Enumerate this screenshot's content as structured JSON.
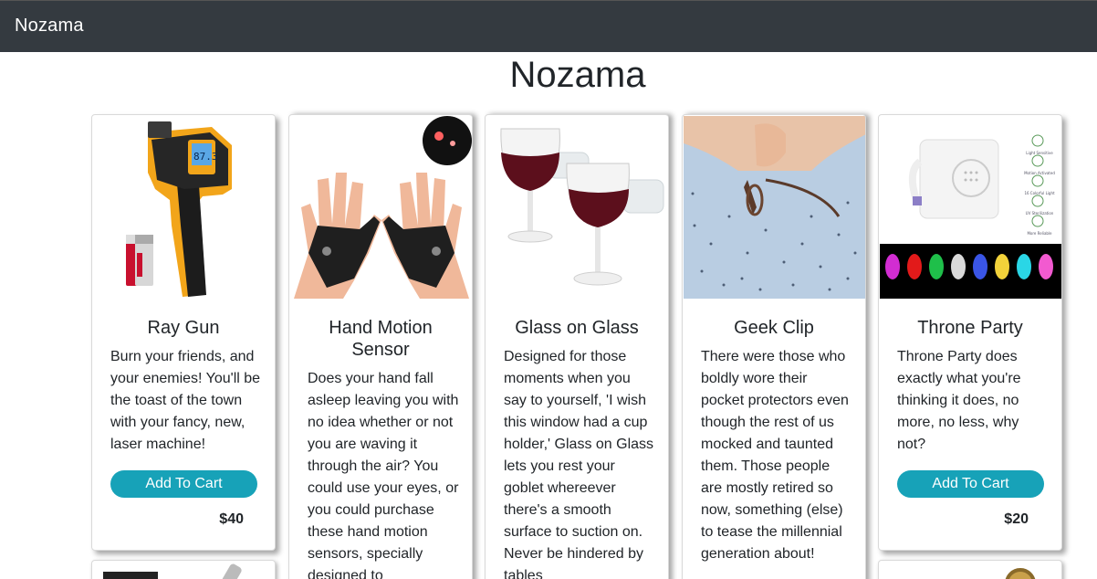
{
  "navbar": {
    "brand": "Nozama"
  },
  "page": {
    "title": "Nozama"
  },
  "products": [
    {
      "name": "Ray Gun",
      "description": "Burn your friends, and your enemies! You'll be the toast of the town with your fancy, new, laser machine!",
      "button": "Add To Cart",
      "price": "$40",
      "icon": "infrared-thermometer-image"
    },
    {
      "name": "Hand Motion Sensor",
      "description": "Does your hand fall asleep leaving you with no idea whether or not you are waving it through the air? You could use your eyes, or you could purchase these hand motion sensors, specially designed to",
      "icon": "led-gloves-image"
    },
    {
      "name": "Glass on Glass",
      "description": "Designed for those moments when you say to yourself, 'I wish this window had a cup holder,' Glass on Glass lets you rest your goblet whereever there's a smooth surface to suction on. Never be hindered by tables",
      "icon": "wine-glass-holder-image"
    },
    {
      "name": "Geek Clip",
      "description": "There were those who boldly wore their pocket protectors even though the rest of us mocked and taunted them. Those people are mostly retired so now, something (else) to tease the millennial generation about!",
      "icon": "glasses-clip-image"
    },
    {
      "name": "Throne Party",
      "description": "Throne Party does exactly what you're thinking it does, no more, no less, why not?",
      "button": "Add To Cart",
      "price": "$20",
      "icon": "toilet-light-image",
      "feature_labels": [
        "Light Sensitive",
        "Motion Activated",
        "16 Colorful Light",
        "UV Sterilization",
        "More Reliable"
      ]
    }
  ],
  "colors": {
    "navbar": "#343a40",
    "button": "#17a2b8"
  }
}
